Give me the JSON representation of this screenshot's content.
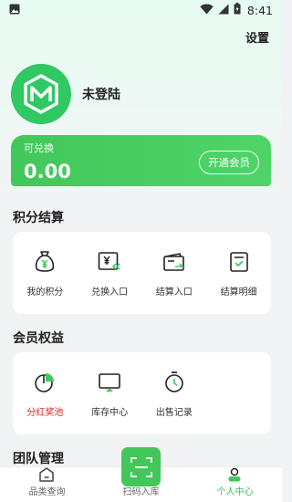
{
  "status_bar": {
    "time": "8:41"
  },
  "header": {
    "settings_label": "设置"
  },
  "profile": {
    "name": "未登陆"
  },
  "balance": {
    "label": "可兑换",
    "value": "0.00",
    "vip_button": "开通会员"
  },
  "points": {
    "title": "积分结算",
    "items": [
      {
        "label": "我的积分",
        "icon": "money-bag-icon"
      },
      {
        "label": "兑换入口",
        "icon": "yen-exchange-icon"
      },
      {
        "label": "结算入口",
        "icon": "wallet-icon"
      },
      {
        "label": "结算明细",
        "icon": "checklist-icon"
      }
    ]
  },
  "benefits": {
    "title": "会员权益",
    "items": [
      {
        "label": "分红奖池",
        "icon": "pie-chart-icon",
        "color": "#e02020"
      },
      {
        "label": "库存中心",
        "icon": "monitor-icon"
      },
      {
        "label": "出售记录",
        "icon": "stopwatch-icon"
      }
    ]
  },
  "team": {
    "title": "团队管理"
  },
  "tabbar": {
    "items": [
      {
        "label": "品类查询",
        "icon": "home-icon"
      },
      {
        "label": "扫码入库",
        "icon": "scan-icon"
      },
      {
        "label": "个人中心",
        "icon": "user-icon",
        "active": true
      }
    ]
  },
  "colors": {
    "brand_green": "#43c65a",
    "accent_red": "#e02020"
  }
}
